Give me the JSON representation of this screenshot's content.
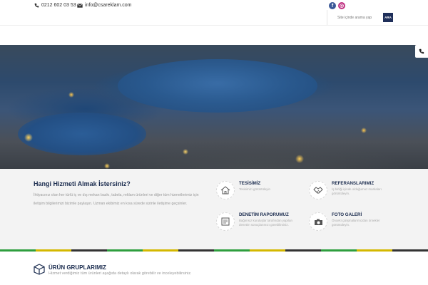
{
  "topbar": {
    "phone": "0212 602 03 53",
    "email": "info@csareklam.com",
    "phone_icon": "phone-icon",
    "email_icon": "envelope-icon",
    "social": [
      {
        "name": "facebook-icon",
        "glyph": "f"
      },
      {
        "name": "instagram-icon",
        "glyph": "◎"
      }
    ]
  },
  "search": {
    "placeholder": "Site içinde arama yap",
    "button_label": "ARA"
  },
  "services": {
    "title": "Hangi Hizmeti Almak İstersiniz?",
    "description": "İhtiyacınız olan her türlü iç ve dış mekan baskı, tabela, reklam ürünleri ve diğer tüm hizmetlerimiz için iletişim bilgilerimizi bizimle paylaşın. Uzman ekibimiz en kısa sürede sizinle iletişime geçsinler.",
    "cards": [
      {
        "title": "TESİSİMİZ",
        "text": "Tesisimizi görüntüleyin",
        "icon": "home-icon"
      },
      {
        "title": "REFERANSLARIMIZ",
        "text": "İş birliği içinde olduğumuz markaları görüntüleyin.",
        "icon": "handshake-icon"
      },
      {
        "title": "DENETİM RAPORUMUZ",
        "text": "Bağımsız kuruluşlar tarafından yapılan denetim sonuçlarımızı görebilirsiniz.",
        "icon": "report-icon"
      },
      {
        "title": "FOTO GALERİ",
        "text": "Önceki çalışmalarımızdan örnekler görüntüleyin.",
        "icon": "camera-icon"
      }
    ]
  },
  "stripe_colors": [
    "#2e9e3e",
    "#d4b800",
    "#333333",
    "#2e9e3e",
    "#d4b800",
    "#333333",
    "#2e9e3e",
    "#d4b800",
    "#333333",
    "#2e9e3e",
    "#d4b800",
    "#333333"
  ],
  "products": {
    "title": "ÜRÜN GRUPLARIMIZ",
    "subtitle": "Hizmet verdiğimiz tüm ürünleri aşağıda detaylı olarak görebilir ve inceleyebilirsiniz.",
    "icon": "box-icon"
  },
  "colors": {
    "navy": "#1a2b4e",
    "button": "#1f2f5a",
    "facebook": "#3b5998",
    "instagram": "#c13584"
  }
}
